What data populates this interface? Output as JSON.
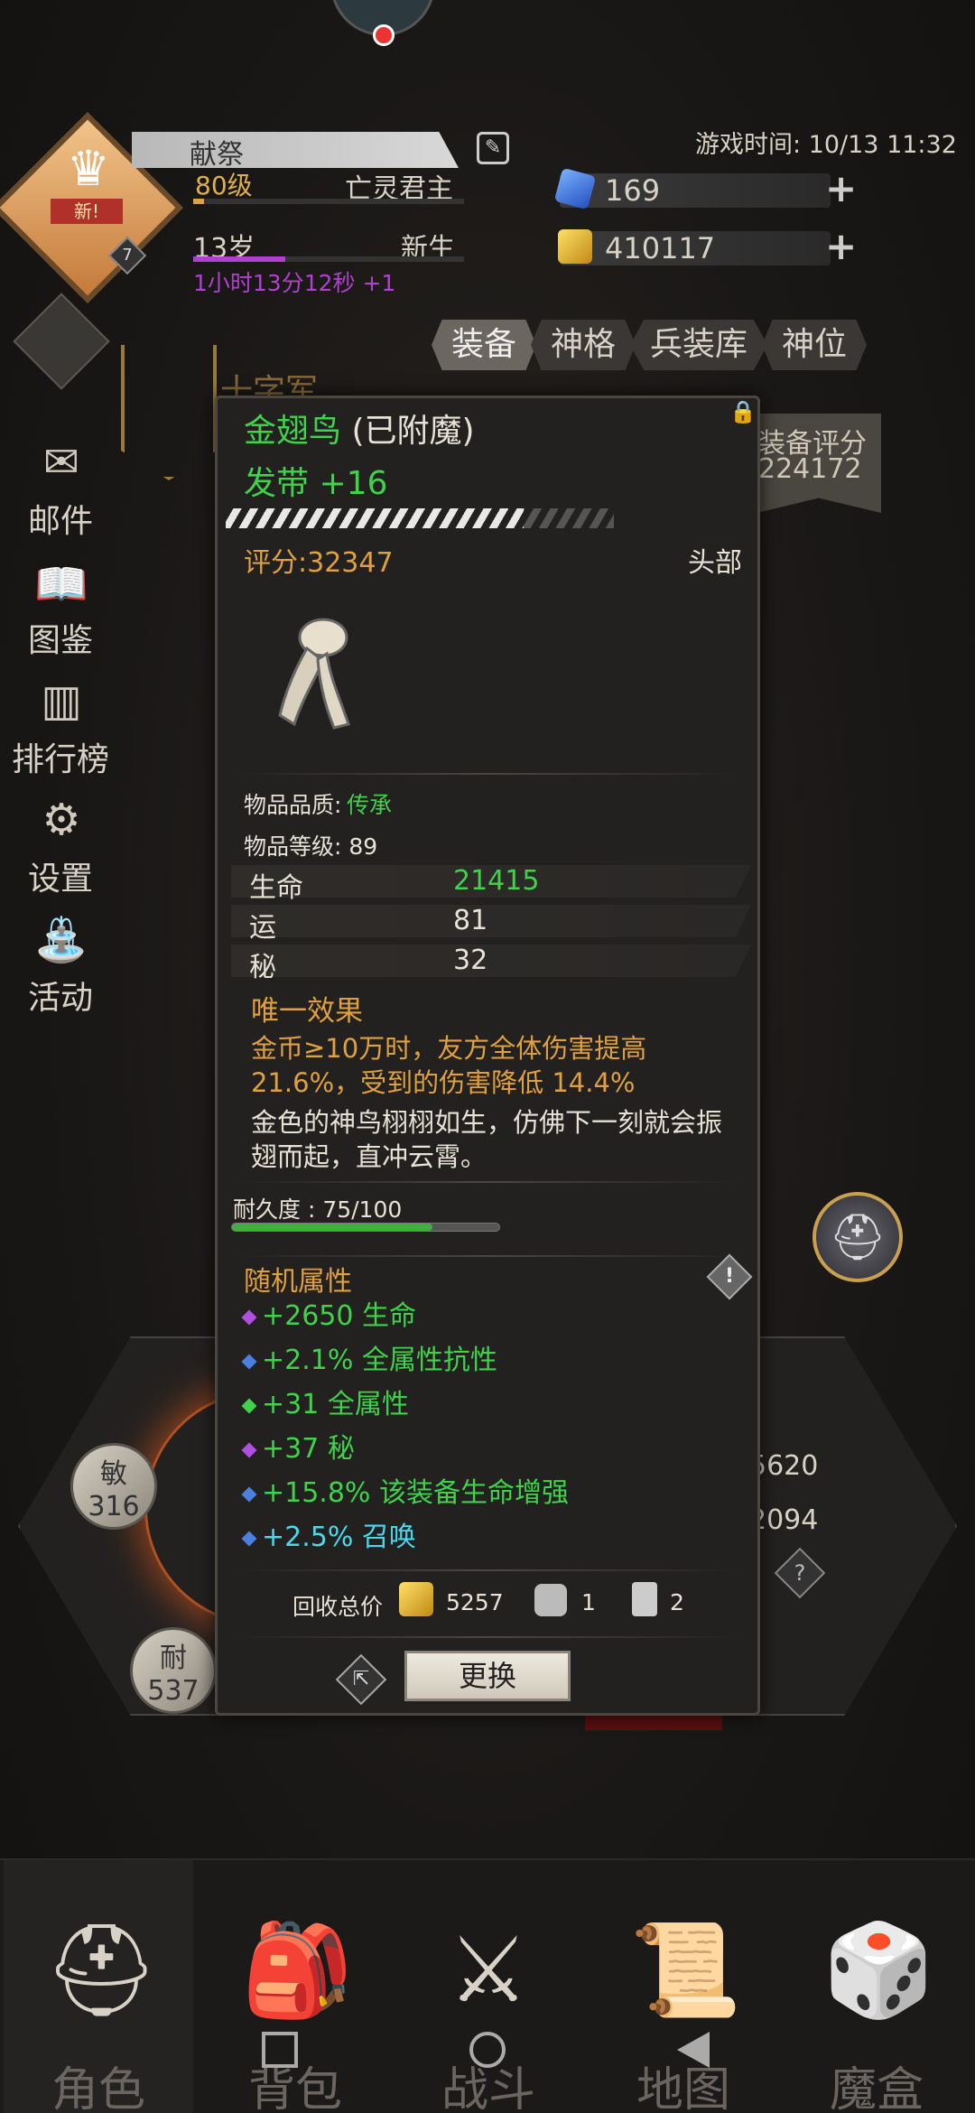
{
  "header": {
    "player_name": "献祭",
    "level": "80级",
    "title": "亡灵君主",
    "age": "13岁",
    "status": "新生",
    "timer": "1小时13分12秒 +1",
    "new_tag": "新!",
    "rank_badge": "7",
    "level_progress": 0.04,
    "age_progress": 0.34,
    "game_time": "游戏时间: 10/13 11:32",
    "gems": "169",
    "gold": "410117"
  },
  "sidebar": {
    "items": [
      {
        "label": "邮件",
        "icon": "mail-icon"
      },
      {
        "label": "图鉴",
        "icon": "book-icon"
      },
      {
        "label": "排行榜",
        "icon": "chart-icon"
      },
      {
        "label": "设置",
        "icon": "gear-icon"
      },
      {
        "label": "活动",
        "icon": "event-icon"
      }
    ]
  },
  "tabs": [
    "装备",
    "神格",
    "兵装库",
    "神位"
  ],
  "equipment": {
    "partial_heading": "十字军",
    "score_label": "装备评分",
    "score_value": "224172"
  },
  "stats_panel": {
    "agi_label": "敏",
    "agi_value": "316",
    "end_label": "耐",
    "end_value": "537",
    "right_val1": "5620",
    "right_val2": "2094"
  },
  "item": {
    "name": "金翅鸟",
    "name_suffix": "(已附魔)",
    "subtitle": "发带 +16",
    "score": "评分:32347",
    "slot": "头部",
    "quality_label": "物品品质:",
    "quality_value": "传承",
    "item_level": "物品等级: 89",
    "stats": [
      {
        "name": "生命",
        "value": "21415"
      },
      {
        "name": "运",
        "value": "81"
      },
      {
        "name": "秘",
        "value": "32"
      }
    ],
    "unique_title": "唯一效果",
    "unique_text": "金币≥10万时，友方全体伤害提高 21.6%，受到的伤害降低 14.4%",
    "flavor_text": "金色的神鸟栩栩如生，仿佛下一刻就会振翅而起，直冲云霄。",
    "durability_label": "耐久度 : 75/100",
    "durability_fraction": 0.75,
    "random_title": "随机属性",
    "random_attrs": [
      {
        "text": "+2650 生命",
        "gem_color": "#b050e0"
      },
      {
        "text": "+2.1% 全属性抗性",
        "gem_color": "#4a80e0"
      },
      {
        "text": "+31 全属性",
        "gem_color": "#3fd24a"
      },
      {
        "text": "+37 秘",
        "gem_color": "#b050e0"
      },
      {
        "text": "+15.8% 该装备生命增强",
        "gem_color": "#4a80e0"
      },
      {
        "text": "+2.5% 召唤",
        "gem_color": "#4a80e0"
      }
    ],
    "salvage_label": "回收总价",
    "salvage_gold": "5257",
    "salvage_mat1": "1",
    "salvage_mat2": "2",
    "replace_label": "更换"
  },
  "nav": [
    {
      "label": "角色",
      "icon": "helmet-icon"
    },
    {
      "label": "背包",
      "icon": "backpack-icon"
    },
    {
      "label": "战斗",
      "icon": "sword-shield-icon"
    },
    {
      "label": "地图",
      "icon": "scroll-map-icon"
    },
    {
      "label": "魔盒",
      "icon": "magic-box-icon"
    }
  ],
  "colors": {
    "legend_green": "#3fd24a",
    "gold_text": "#e0a040",
    "cyan_attr": "#4ad8ee"
  }
}
